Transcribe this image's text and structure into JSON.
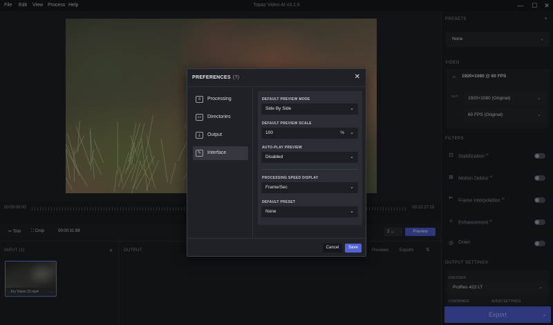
{
  "app": {
    "title": "Topaz Video AI  v3.1.6",
    "menu": [
      "File",
      "Edit",
      "View",
      "Process",
      "Help"
    ],
    "window_controls": {
      "minimize": "—",
      "maximize": "☐",
      "close": "✕"
    }
  },
  "timeline": {
    "start": "00:00:00:00",
    "end": "00:12:27:13"
  },
  "controls": {
    "trim": "Trim",
    "crop": "Crop",
    "duration": "00:00:31:98",
    "zoom": "2 ⌄",
    "preview": "Preview"
  },
  "input": {
    "title": "INPUT  (1)",
    "add": "+",
    "file": {
      "name": "...ltry Vision 32.mp4",
      "more": "···"
    }
  },
  "output": {
    "title": "OUTPUT",
    "tabs": [
      "Previews",
      "Exports"
    ],
    "sort": "⇅"
  },
  "right": {
    "presets": {
      "title": "PRESETS",
      "add": "+",
      "value": "None"
    },
    "video": {
      "title": "VIDEO",
      "in_label": "IN",
      "in_value": "1920×1080 @ 60 FPS",
      "out_label": "OUT",
      "resolution": "1920×1080 (Original)",
      "fps": "60 FPS (Original)"
    },
    "filters": {
      "title": "FILTERS",
      "items": [
        {
          "label": "Stabilization",
          "sup": "AI",
          "icon": "⊡"
        },
        {
          "label": "Motion Deblur",
          "sup": "AI",
          "icon": "⊞"
        },
        {
          "label": "Frame Interpolation",
          "sup": "AI",
          "icon": "●◐"
        },
        {
          "label": "Enhancement",
          "sup": "AI",
          "icon": "✧"
        },
        {
          "label": "Grain",
          "sup": "",
          "icon": "◎"
        }
      ]
    },
    "output_settings": {
      "title": "OUTPUT SETTINGS",
      "encoder_label": "ENCODER",
      "encoder": "ProRes 422 LT",
      "container_label": "CONTAINER",
      "audio_label": "AUDIO SETTINGS"
    },
    "export": "Export"
  },
  "dialog": {
    "title": "PREFERENCES",
    "help": "(?)",
    "close": "✕",
    "nav": [
      {
        "label": "Processing",
        "icon": "≡"
      },
      {
        "label": "Directories",
        "icon": "▭"
      },
      {
        "label": "Output",
        "icon": "⤓"
      },
      {
        "label": "Interface",
        "icon": "✎"
      }
    ],
    "options": {
      "preview_mode_title": "DEFAULT PREVIEW MODE",
      "preview_mode": "Side By Side",
      "preview_scale_title": "DEFAULT PREVIEW SCALE",
      "preview_scale": "100",
      "preview_scale_unit": "%",
      "autoplay_title": "AUTO-PLAY PREVIEW",
      "autoplay": "Disabled",
      "speed_title": "PROCESSING SPEED DISPLAY",
      "speed": "Frame/Sec",
      "preset_title": "DEFAULT PRESET",
      "preset": "None"
    },
    "cancel": "Cancel",
    "save": "Save"
  }
}
